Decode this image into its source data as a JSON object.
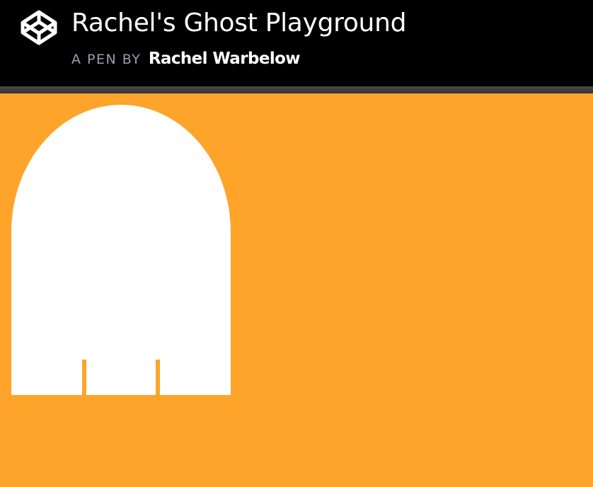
{
  "header": {
    "title": "Rachel's Ghost Playground",
    "byline_prefix": "A PEN BY",
    "author": "Rachel Warbelow",
    "logo_icon": "codepen-logo-icon"
  },
  "stage": {
    "background_color": "#FEA42B",
    "ghost_color": "#FFFFFF"
  }
}
